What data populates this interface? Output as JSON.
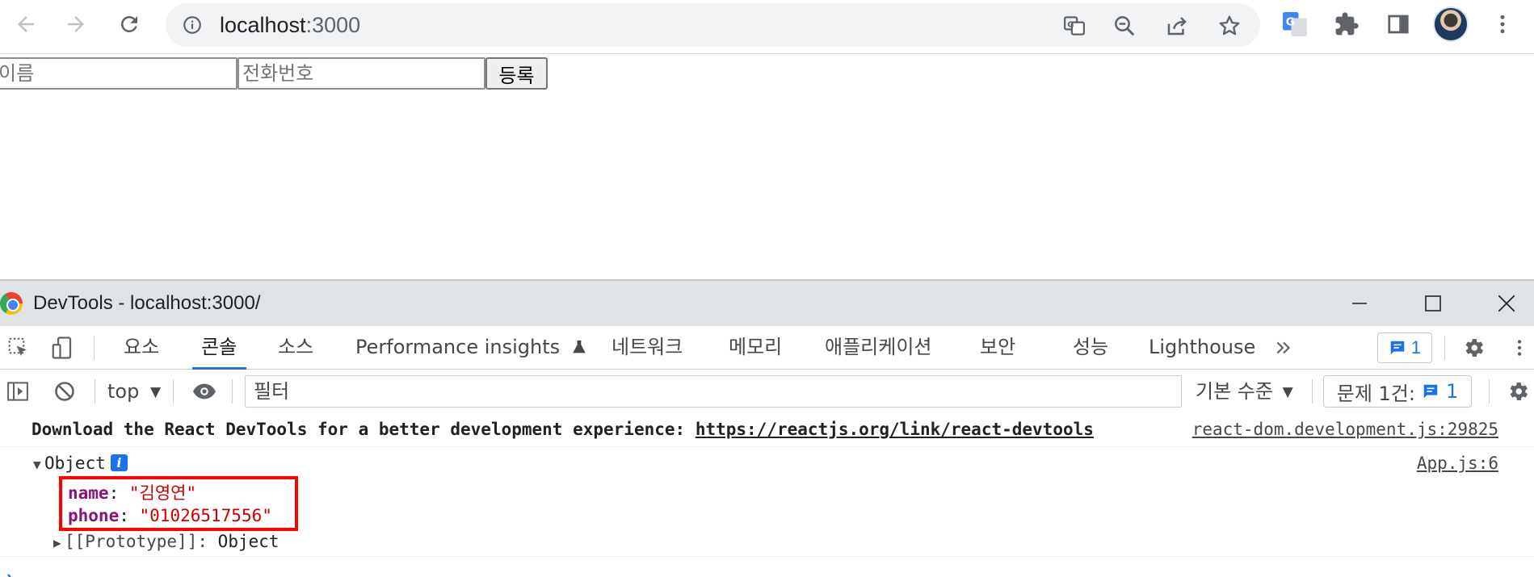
{
  "browser": {
    "url_host": "localhost",
    "url_port": ":3000"
  },
  "page": {
    "name_placeholder": "이름",
    "phone_placeholder": "전화번호",
    "submit_label": "등록"
  },
  "devtools": {
    "window_title": "DevTools - localhost:3000/",
    "tabs": [
      {
        "label": "요소"
      },
      {
        "label": "콘솔",
        "active": true
      },
      {
        "label": "소스"
      },
      {
        "label": "Performance insights"
      },
      {
        "label": "네트워크"
      },
      {
        "label": "메모리"
      },
      {
        "label": "애플리케이션"
      },
      {
        "label": "보안"
      },
      {
        "label": "성능"
      },
      {
        "label": "Lighthouse"
      }
    ],
    "issue_count": "1",
    "console_bar": {
      "context": "top",
      "filter_placeholder": "필터",
      "level": "기본 수준",
      "issues_label": "문제 1건:",
      "issues_count": "1"
    },
    "messages": {
      "react_devtools_text": "Download the React DevTools for a better development experience:",
      "react_devtools_link": "https://reactjs.org/link/react-devtools",
      "react_devtools_source": "react-dom.development.js:29825",
      "object_label": "Object",
      "object_source": "App.js:6",
      "props": [
        {
          "key": "name",
          "value": "\"김영연\""
        },
        {
          "key": "phone",
          "value": "\"01026517556\""
        }
      ],
      "prototype_label": "[[Prototype]]",
      "prototype_value": "Object"
    }
  },
  "colors": {
    "accent": "#1a73e8",
    "highlight_border": "#ff0000",
    "property_key": "#881280",
    "string_value": "#c80000"
  }
}
